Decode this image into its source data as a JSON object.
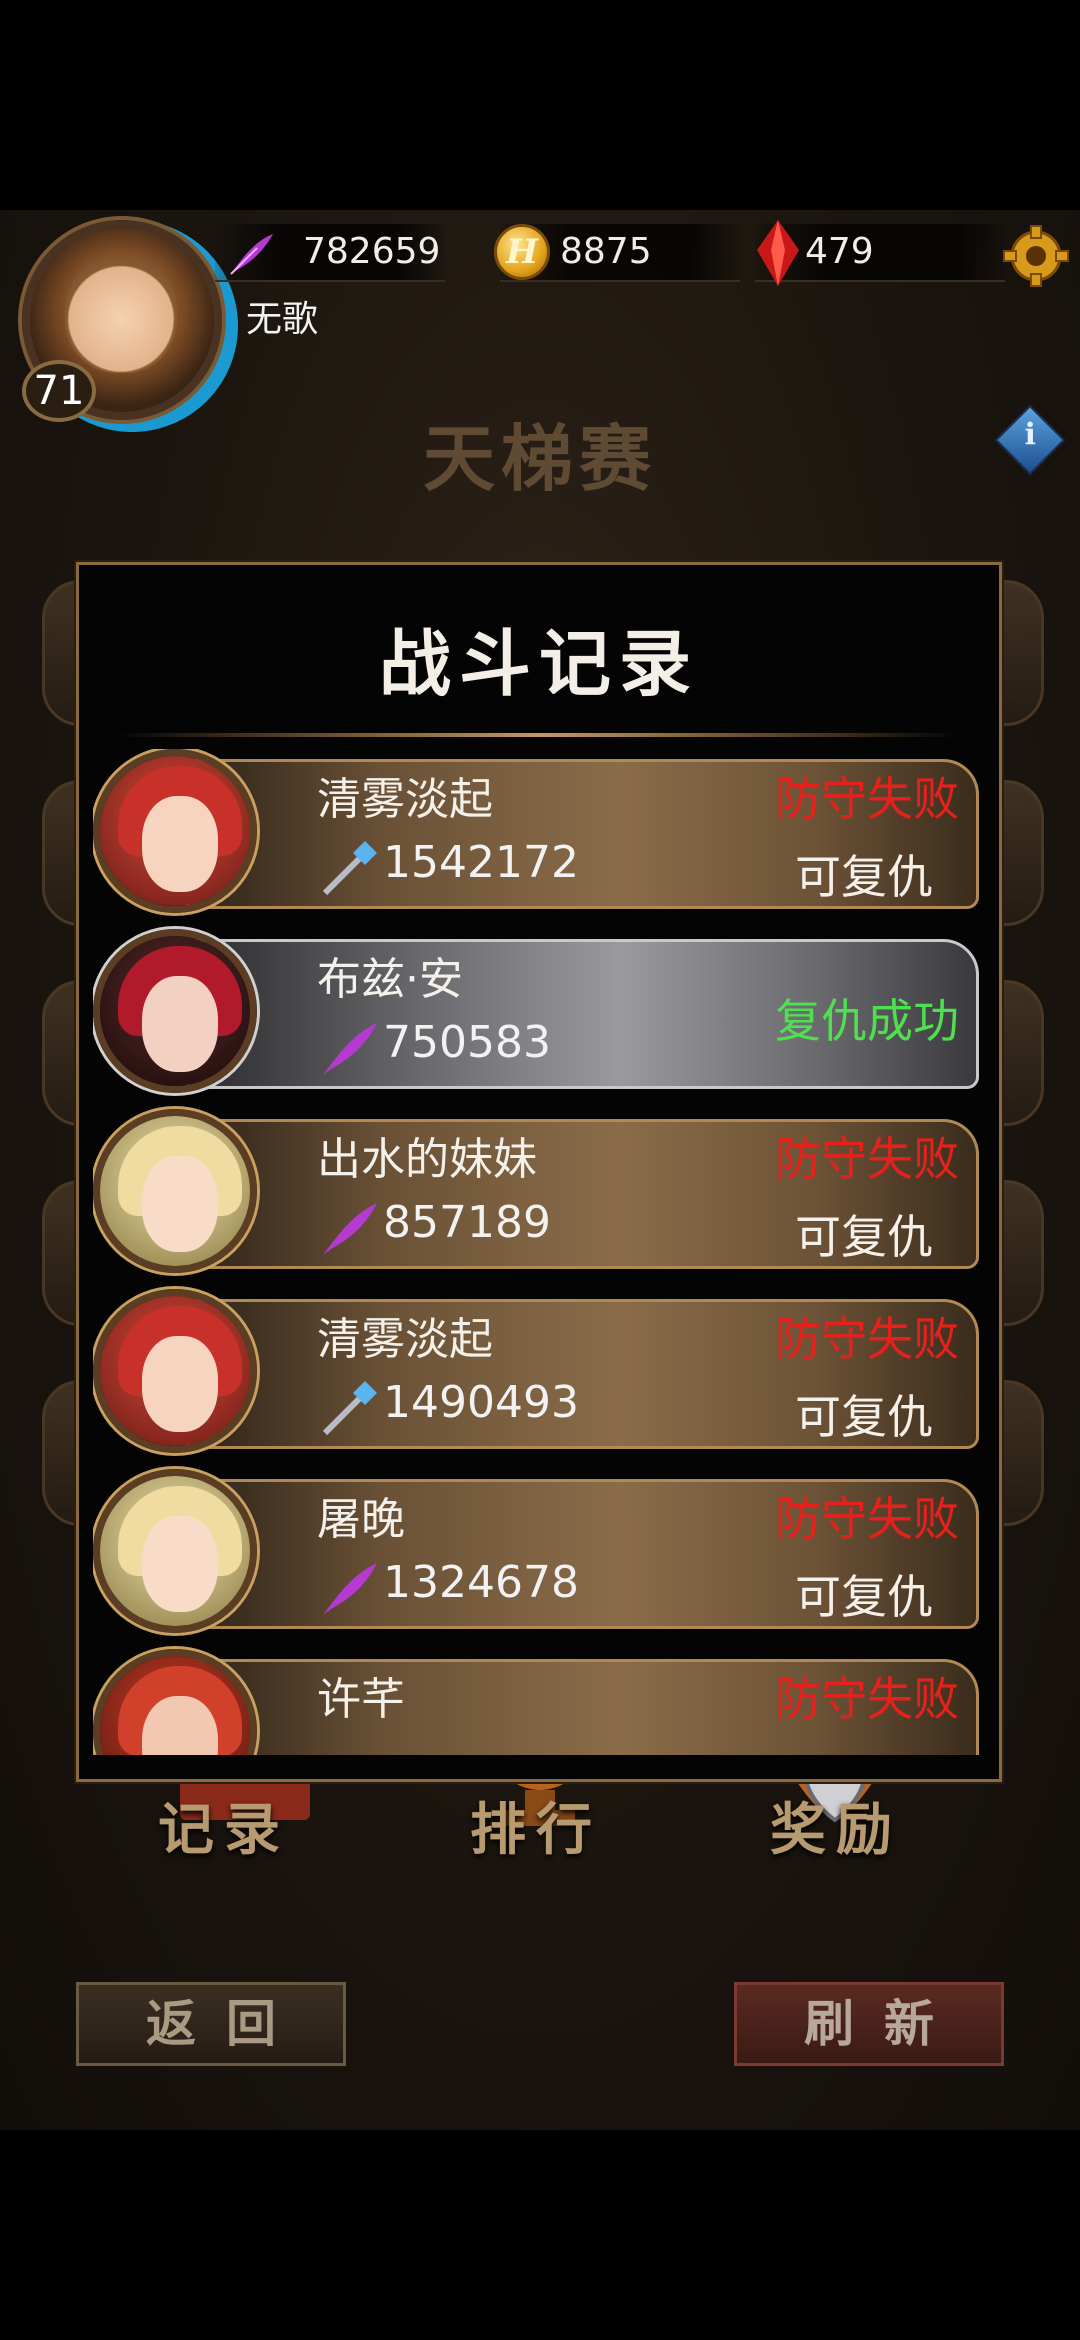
{
  "header": {
    "player_name": "无歌",
    "level": "71",
    "resources": [
      {
        "icon": "feather-icon",
        "value": "782659"
      },
      {
        "icon": "gold-coin-icon",
        "value": "8875",
        "coin_letter": "H"
      },
      {
        "icon": "red-gem-icon",
        "value": "479"
      }
    ]
  },
  "page_title": "天梯赛",
  "info_label": "i",
  "modal": {
    "title": "战斗记录",
    "records": [
      {
        "name": "清雾淡起",
        "power": "1542172",
        "status": "防守失败",
        "action": "可复仇",
        "weapon": "staff-icon",
        "theme": "gold"
      },
      {
        "name": "布兹·安",
        "power": "750583",
        "status": "复仇成功",
        "action": "",
        "weapon": "feather-icon",
        "theme": "silver"
      },
      {
        "name": "出水的妹妹",
        "power": "857189",
        "status": "防守失败",
        "action": "可复仇",
        "weapon": "feather-icon",
        "theme": "gold"
      },
      {
        "name": "清雾淡起",
        "power": "1490493",
        "status": "防守失败",
        "action": "可复仇",
        "weapon": "staff-icon",
        "theme": "gold"
      },
      {
        "name": "屠晚",
        "power": "1324678",
        "status": "防守失败",
        "action": "可复仇",
        "weapon": "feather-icon",
        "theme": "gold"
      },
      {
        "name": "许芊",
        "power": "",
        "status": "防守失败",
        "action": "",
        "weapon": "",
        "theme": "gold"
      }
    ]
  },
  "bottom_nav": [
    {
      "label": "记录"
    },
    {
      "label": "排行"
    },
    {
      "label": "奖励"
    }
  ],
  "buttons": {
    "back": "返回",
    "refresh": "刷新"
  },
  "colors": {
    "defeat": "#e8201c",
    "success": "#4ee04e",
    "gold_border": "#b08a52"
  }
}
